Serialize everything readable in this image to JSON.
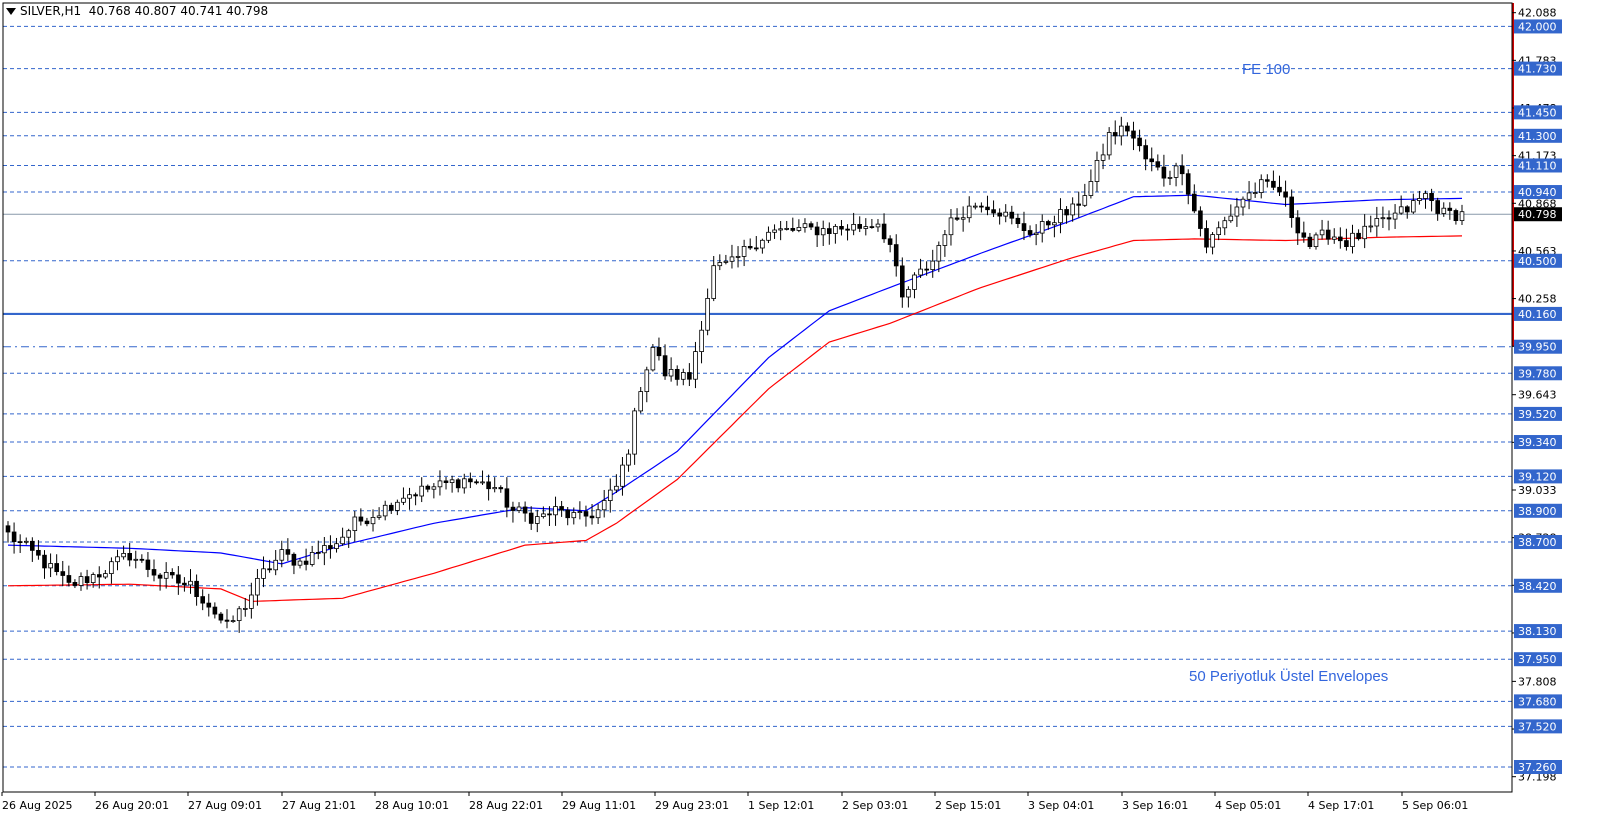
{
  "header": {
    "symbol": "SILVER,H1",
    "ohlc": "40.768 40.807 40.741 40.798"
  },
  "annotations": {
    "fe100": "FE 100",
    "envelopes": "50 Periyotluk Üstel Envelopes"
  },
  "colors": {
    "blue_line": "#0000ff",
    "red_line": "#ff0000",
    "level_line": "#3366cc",
    "candle_bull": "#ffffff",
    "candle_bear": "#000000",
    "axis_red_bar": "#cc0000",
    "current_price_bg": "#000000"
  },
  "chart_data": {
    "type": "candlestick",
    "ylim": [
      37.1,
      42.15
    ],
    "price_ticks": [
      "42.088",
      "41.783",
      "41.478",
      "41.173",
      "40.868",
      "40.563",
      "40.258",
      "39.953",
      "39.643",
      "39.338",
      "39.033",
      "38.728",
      "38.423",
      "38.118",
      "37.808",
      "37.503",
      "37.198"
    ],
    "current_price": 40.798,
    "current_price_label": "40.798",
    "levels": [
      {
        "label": "42.000",
        "value": 42.0,
        "style": "dashed"
      },
      {
        "label": "41.730",
        "value": 41.73,
        "style": "dashed"
      },
      {
        "label": "41.450",
        "value": 41.45,
        "style": "dashed"
      },
      {
        "label": "41.300",
        "value": 41.3,
        "style": "dashed"
      },
      {
        "label": "41.110",
        "value": 41.11,
        "style": "dashed"
      },
      {
        "label": "40.940",
        "value": 40.94,
        "style": "dashed"
      },
      {
        "label": "40.500",
        "value": 40.5,
        "style": "dashed"
      },
      {
        "label": "40.160",
        "value": 40.16,
        "style": "solid"
      },
      {
        "label": "39.950",
        "value": 39.95,
        "style": "dashdot"
      },
      {
        "label": "39.780",
        "value": 39.78,
        "style": "dashed"
      },
      {
        "label": "39.520",
        "value": 39.52,
        "style": "dashed"
      },
      {
        "label": "39.340",
        "value": 39.34,
        "style": "dashed"
      },
      {
        "label": "39.120",
        "value": 39.12,
        "style": "dashed"
      },
      {
        "label": "38.900",
        "value": 38.9,
        "style": "dashed"
      },
      {
        "label": "38.700",
        "value": 38.7,
        "style": "dashed"
      },
      {
        "label": "38.420",
        "value": 38.42,
        "style": "dashed"
      },
      {
        "label": "38.130",
        "value": 38.13,
        "style": "dashed"
      },
      {
        "label": "37.950",
        "value": 37.95,
        "style": "dashed"
      },
      {
        "label": "37.680",
        "value": 37.68,
        "style": "dashed"
      },
      {
        "label": "37.520",
        "value": 37.52,
        "style": "dashed"
      },
      {
        "label": "37.260",
        "value": 37.26,
        "style": "dashed"
      }
    ],
    "x_labels": [
      "26 Aug 2025",
      "26 Aug 20:01",
      "27 Aug 09:01",
      "27 Aug 21:01",
      "28 Aug 10:01",
      "28 Aug 22:01",
      "29 Aug 11:01",
      "29 Aug 23:01",
      "1 Sep 12:01",
      "2 Sep 03:01",
      "2 Sep 15:01",
      "3 Sep 04:01",
      "3 Sep 16:01",
      "4 Sep 05:01",
      "4 Sep 17:01",
      "5 Sep 06:01"
    ],
    "series": [
      {
        "name": "",
        "color": "#0000ff",
        "anchors": [
          [
            0,
            38.68
          ],
          [
            20,
            38.66
          ],
          [
            35,
            38.63
          ],
          [
            45,
            38.56
          ],
          [
            55,
            38.68
          ],
          [
            70,
            38.82
          ],
          [
            85,
            38.92
          ],
          [
            95,
            38.9
          ],
          [
            100,
            39.02
          ],
          [
            110,
            39.28
          ],
          [
            125,
            39.88
          ],
          [
            135,
            40.18
          ],
          [
            145,
            40.33
          ],
          [
            160,
            40.55
          ],
          [
            175,
            40.76
          ],
          [
            185,
            40.91
          ],
          [
            195,
            40.92
          ],
          [
            210,
            40.86
          ],
          [
            225,
            40.89
          ],
          [
            240,
            40.9
          ]
        ]
      },
      {
        "name": "",
        "color": "#ff0000",
        "anchors": [
          [
            0,
            38.42
          ],
          [
            20,
            38.43
          ],
          [
            35,
            38.4
          ],
          [
            40,
            38.32
          ],
          [
            55,
            38.34
          ],
          [
            70,
            38.5
          ],
          [
            85,
            38.68
          ],
          [
            95,
            38.71
          ],
          [
            100,
            38.82
          ],
          [
            110,
            39.1
          ],
          [
            125,
            39.68
          ],
          [
            135,
            39.98
          ],
          [
            145,
            40.1
          ],
          [
            160,
            40.33
          ],
          [
            175,
            40.52
          ],
          [
            185,
            40.63
          ],
          [
            195,
            40.64
          ],
          [
            210,
            40.63
          ],
          [
            225,
            40.65
          ],
          [
            240,
            40.66
          ]
        ]
      }
    ],
    "price_path_anchors": [
      [
        0,
        38.75
      ],
      [
        5,
        38.6
      ],
      [
        10,
        38.42
      ],
      [
        15,
        38.5
      ],
      [
        20,
        38.62
      ],
      [
        25,
        38.48
      ],
      [
        30,
        38.42
      ],
      [
        33,
        38.3
      ],
      [
        36,
        38.15
      ],
      [
        39,
        38.3
      ],
      [
        42,
        38.5
      ],
      [
        45,
        38.62
      ],
      [
        48,
        38.57
      ],
      [
        51,
        38.64
      ],
      [
        54,
        38.7
      ],
      [
        57,
        38.82
      ],
      [
        62,
        38.92
      ],
      [
        65,
        39.0
      ],
      [
        70,
        39.05
      ],
      [
        75,
        39.1
      ],
      [
        80,
        39.05
      ],
      [
        83,
        38.9
      ],
      [
        87,
        38.85
      ],
      [
        90,
        38.9
      ],
      [
        94,
        38.85
      ],
      [
        97,
        38.9
      ],
      [
        100,
        39.05
      ],
      [
        102,
        39.3
      ],
      [
        104,
        39.7
      ],
      [
        106,
        39.95
      ],
      [
        108,
        39.78
      ],
      [
        112,
        39.75
      ],
      [
        114,
        40.1
      ],
      [
        116,
        40.45
      ],
      [
        119,
        40.48
      ],
      [
        122,
        40.6
      ],
      [
        125,
        40.68
      ],
      [
        130,
        40.7
      ],
      [
        135,
        40.7
      ],
      [
        140,
        40.72
      ],
      [
        143,
        40.75
      ],
      [
        145,
        40.6
      ],
      [
        147,
        40.25
      ],
      [
        149,
        40.38
      ],
      [
        152,
        40.5
      ],
      [
        154,
        40.7
      ],
      [
        157,
        40.82
      ],
      [
        160,
        40.88
      ],
      [
        163,
        40.82
      ],
      [
        166,
        40.72
      ],
      [
        169,
        40.68
      ],
      [
        172,
        40.78
      ],
      [
        175,
        40.82
      ],
      [
        178,
        41.0
      ],
      [
        181,
        41.3
      ],
      [
        184,
        41.35
      ],
      [
        187,
        41.15
      ],
      [
        190,
        41.05
      ],
      [
        193,
        41.1
      ],
      [
        195,
        40.82
      ],
      [
        197,
        40.6
      ],
      [
        200,
        40.75
      ],
      [
        203,
        40.9
      ],
      [
        206,
        40.98
      ],
      [
        209,
        40.95
      ],
      [
        212,
        40.72
      ],
      [
        214,
        40.6
      ],
      [
        217,
        40.68
      ],
      [
        220,
        40.62
      ],
      [
        223,
        40.68
      ],
      [
        226,
        40.75
      ],
      [
        230,
        40.83
      ],
      [
        233,
        40.92
      ],
      [
        236,
        40.8
      ],
      [
        240,
        40.8
      ]
    ]
  }
}
